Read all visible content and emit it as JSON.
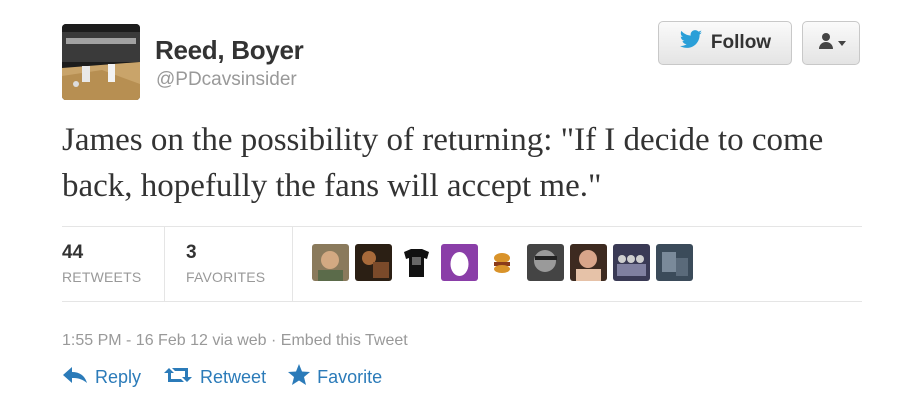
{
  "user": {
    "name": "Reed, Boyer",
    "handle": "@PDcavsinsider"
  },
  "buttons": {
    "follow_label": "Follow",
    "user_menu": "user-dropdown"
  },
  "tweet": {
    "text": "James on the possibility of returning: \"If I decide to come back, hopefully the fans will accept me.\""
  },
  "stats": {
    "retweets_count": "44",
    "retweets_label": "RETWEETS",
    "favorites_count": "3",
    "favorites_label": "FAVORITES"
  },
  "meta": {
    "time": "1:55 PM - 16 Feb 12",
    "via": "via web",
    "separator": "·",
    "embed": "Embed this Tweet"
  },
  "actions": {
    "reply": "Reply",
    "retweet": "Retweet",
    "favorite": "Favorite"
  },
  "colors": {
    "link": "#2b7bb9",
    "twitter_bird": "#2a9fd8",
    "muted": "#999999"
  }
}
